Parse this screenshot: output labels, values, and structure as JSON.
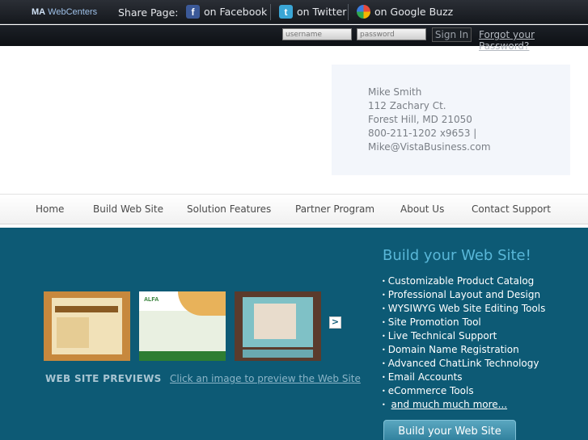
{
  "topbar": {
    "brand_prefix": "MA",
    "brand_name": "WebCenters",
    "share_label": "Share Page:",
    "facebook": "on Facebook",
    "twitter": "on Twitter",
    "buzz": "on Google Buzz"
  },
  "login": {
    "username_placeholder": "username",
    "password_placeholder": "password",
    "signin_label": "Sign In",
    "forgot_label": "Forgot your Password?"
  },
  "contact": {
    "name": "Mike Smith",
    "street": "112 Zachary Ct.",
    "city": "Forest Hill, MD 21050",
    "phone": "800-211-1202 x9653 |",
    "email": "Mike@VistaBusiness.com"
  },
  "nav": {
    "items": [
      "Home",
      "Build Web Site",
      "Solution Features",
      "Partner Program",
      "About Us",
      "Contact Support"
    ]
  },
  "previews": {
    "title": "WEB SITE PREVIEWS",
    "link": "Click an image to preview the Web Site",
    "next": ">",
    "thumb2_logo": "ALFA"
  },
  "build": {
    "title": "Build your Web Site!",
    "features": [
      "Customizable Product Catalog",
      "Professional Layout and Design",
      "WYSIWYG Web Site Editing Tools",
      "Site Promotion Tool",
      "Live Technical Support",
      "Domain Name Registration",
      "Advanced ChatLink Technology",
      "Email Accounts",
      "eCommerce Tools"
    ],
    "more": "and much much more...",
    "button": "Build your Web Site"
  },
  "colors": {
    "main_bg": "#0d5a75",
    "title_accent": "#59b7d8",
    "facebook": "#3b5998",
    "twitter": "#3aa6d6"
  },
  "icons": [
    "facebook-icon",
    "twitter-icon",
    "google-buzz-icon",
    "next-arrow-icon"
  ]
}
